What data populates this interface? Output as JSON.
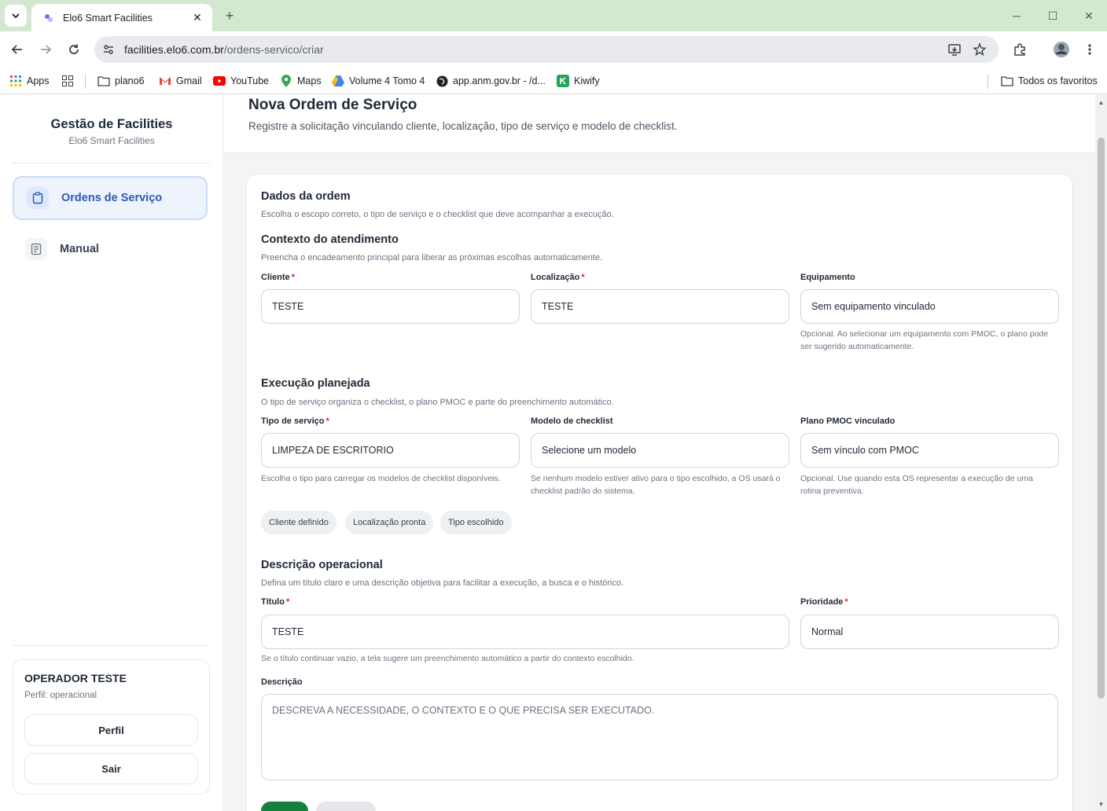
{
  "browser": {
    "tab_title": "Elo6 Smart Facilities",
    "url_host": "facilities.elo6.com.br",
    "url_path": "/ordens-servico/criar",
    "bookmarks": [
      {
        "label": "Apps",
        "icon": "apps-grid-icon"
      },
      {
        "label": "",
        "icon": "grid-icon"
      },
      {
        "label": "plano6",
        "icon": "folder-icon"
      },
      {
        "label": "Gmail",
        "icon": "gmail-icon"
      },
      {
        "label": "YouTube",
        "icon": "youtube-icon"
      },
      {
        "label": "Maps",
        "icon": "maps-icon"
      },
      {
        "label": "Volume 4 Tomo 4",
        "icon": "drive-icon"
      },
      {
        "label": "app.anm.gov.br - /d...",
        "icon": "globe-icon"
      },
      {
        "label": "Kiwify",
        "icon": "kiwify-icon"
      }
    ],
    "all_bookmarks": "Todos os favoritos"
  },
  "sidebar": {
    "brand_title": "Gestão de Facilities",
    "brand_subtitle": "Elo6 Smart Facilities",
    "items": [
      {
        "label": "Ordens de Serviço",
        "icon": "clipboard-icon",
        "active": true
      },
      {
        "label": "Manual",
        "icon": "document-icon",
        "active": false
      }
    ],
    "user": {
      "name": "OPERADOR TESTE",
      "role": "Perfil: operacional",
      "profile_button": "Perfil",
      "logout_button": "Sair"
    }
  },
  "page": {
    "title": "Nova Ordem de Serviço",
    "subtitle": "Registre a solicitação vinculando cliente, localização, tipo de serviço e modelo de checklist."
  },
  "form": {
    "title": "Dados da ordem",
    "subtitle": "Escolha o escopo correto, o tipo de serviço e o checklist que deve acompanhar a execução.",
    "context": {
      "title": "Contexto do atendimento",
      "subtitle": "Preencha o encadeamento principal para liberar as próximas escolhas automaticamente.",
      "client_label": "Cliente",
      "client_value": "TESTE",
      "location_label": "Localização",
      "location_value": "TESTE",
      "equipment_label": "Equipamento",
      "equipment_value": "Sem equipamento vinculado",
      "equipment_help": "Opcional. Ao selecionar um equipamento com PMOC, o plano pode ser sugerido automaticamente."
    },
    "execution": {
      "title": "Execução planejada",
      "subtitle": "O tipo de serviço organiza o checklist, o plano PMOC e parte do preenchimento automático.",
      "service_type_label": "Tipo de serviço",
      "service_type_value": "LIMPEZA DE ESCRITORIO",
      "service_type_help": "Escolha o tipo para carregar os modelos de checklist disponíveis.",
      "checklist_label": "Modelo de checklist",
      "checklist_value": "Selecione um modelo",
      "checklist_help": "Se nenhum modelo estiver ativo para o tipo escolhido, a OS usará o checklist padrão do sistema.",
      "pmoc_label": "Plano PMOC vinculado",
      "pmoc_value": "Sem vínculo com PMOC",
      "pmoc_help": "Opcional. Use quando esta OS representar a execução de uma rotina preventiva.",
      "chips": [
        "Cliente definido",
        "Localização pronta",
        "Tipo escolhido"
      ]
    },
    "description": {
      "title": "Descrição operacional",
      "subtitle": "Defina um título claro e uma descrição objetiva para facilitar a execução, a busca e o histórico.",
      "title_label": "Título",
      "title_value": "TESTE",
      "title_help": "Se o título continuar vazio, a tela sugere um preenchimento automático a partir do contexto escolhido.",
      "priority_label": "Prioridade",
      "priority_value": "Normal",
      "description_label": "Descrição",
      "description_placeholder": "DESCREVA A NECESSIDADE, O CONTEXTO E O QUE PRECISA SER EXECUTADO."
    },
    "required_mark": "*"
  },
  "colors": {
    "accent_blue": "#2a5bb6",
    "active_bg": "#eef4fe",
    "primary_green": "#15803d",
    "required_red": "#dc2626",
    "tabbar_green": "#d3e9cf"
  }
}
